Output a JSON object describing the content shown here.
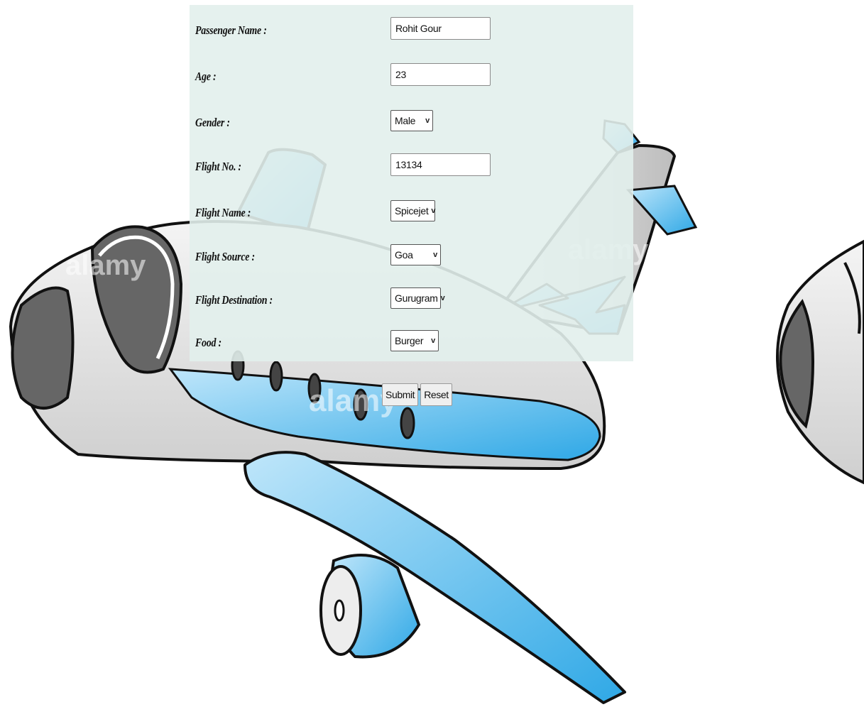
{
  "form": {
    "fields": [
      {
        "label": "Passenger Name :",
        "value": "Rohit Gour",
        "type": "text"
      },
      {
        "label": "Age :",
        "value": "23",
        "type": "text"
      },
      {
        "label": "Gender :",
        "value": "Male",
        "type": "select"
      },
      {
        "label": "Flight No. :",
        "value": "13134",
        "type": "text"
      },
      {
        "label": "Flight Name :",
        "value": "Spicejet",
        "type": "select"
      },
      {
        "label": "Flight Source :",
        "value": "Goa",
        "type": "select"
      },
      {
        "label": "Flight Destination :",
        "value": "Gurugram",
        "type": "select"
      },
      {
        "label": "Food :",
        "value": "Burger",
        "type": "select"
      }
    ],
    "submit_label": "Submit",
    "reset_label": "Reset"
  },
  "background": {
    "image_icon": "cartoon-airplane-illustration",
    "watermark": "alamy",
    "colors": {
      "plane_blue": "#3fb3ea",
      "plane_body": "#e6e6e6",
      "outline": "#1a1a1a",
      "panel": "#e2efec"
    }
  }
}
